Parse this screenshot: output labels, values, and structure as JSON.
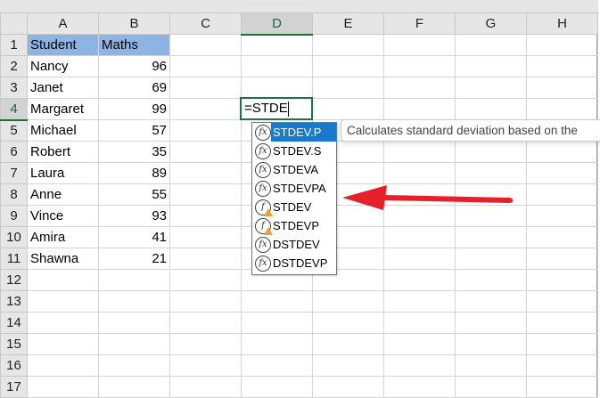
{
  "columns": [
    "A",
    "B",
    "C",
    "D",
    "E",
    "F",
    "G",
    "H"
  ],
  "rows": [
    [
      "Student",
      "Maths"
    ],
    [
      "Nancy",
      "96"
    ],
    [
      "Janet",
      "69"
    ],
    [
      "Margaret",
      "99"
    ],
    [
      "Michael",
      "57"
    ],
    [
      "Robert",
      "35"
    ],
    [
      "Laura",
      "89"
    ],
    [
      "Anne",
      "55"
    ],
    [
      "Vince",
      "93"
    ],
    [
      "Amira",
      "41"
    ],
    [
      "Shawna",
      "21"
    ],
    [],
    [],
    [],
    [],
    [],
    []
  ],
  "active_cell": {
    "ref": "D4",
    "value": "=STDE"
  },
  "autocomplete": {
    "items": [
      {
        "label": "STDEV.P",
        "icon": "fx-icon",
        "selected": true
      },
      {
        "label": "STDEV.S",
        "icon": "fx-icon"
      },
      {
        "label": "STDEVA",
        "icon": "fx-icon"
      },
      {
        "label": "STDEVPA",
        "icon": "fx-icon"
      },
      {
        "label": "STDEV",
        "icon": "fx-warning-icon"
      },
      {
        "label": "STDEVP",
        "icon": "fx-warning-icon"
      },
      {
        "label": "DSTDEV",
        "icon": "fx-icon"
      },
      {
        "label": "DSTDEVP",
        "icon": "fx-icon"
      }
    ],
    "tooltip": "Calculates standard deviation based on the"
  },
  "colors": {
    "header_fill": "#8eb4e3",
    "selection": "#217346",
    "highlight": "#1979ca",
    "arrow": "#e8202a"
  }
}
